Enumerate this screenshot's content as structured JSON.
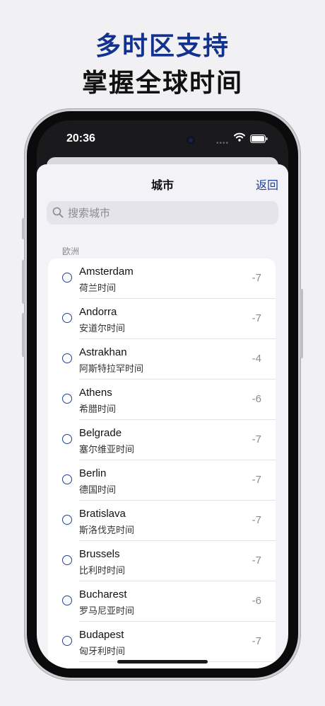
{
  "headline": {
    "line1": "多时区支持",
    "line2": "掌握全球时间"
  },
  "status_bar": {
    "time": "20:36"
  },
  "nav": {
    "title": "城市",
    "back_label": "返回"
  },
  "search": {
    "placeholder": "搜索城市",
    "value": ""
  },
  "section": {
    "header": "欧洲"
  },
  "cities": [
    {
      "name": "Amsterdam",
      "zh": "荷兰时间",
      "offset": "-7"
    },
    {
      "name": "Andorra",
      "zh": "安道尔时间",
      "offset": "-7"
    },
    {
      "name": "Astrakhan",
      "zh": "阿斯特拉罕时间",
      "offset": "-4"
    },
    {
      "name": "Athens",
      "zh": "希腊时间",
      "offset": "-6"
    },
    {
      "name": "Belgrade",
      "zh": "塞尔维亚时间",
      "offset": "-7"
    },
    {
      "name": "Berlin",
      "zh": "德国时间",
      "offset": "-7"
    },
    {
      "name": "Bratislava",
      "zh": "斯洛伐克时间",
      "offset": "-7"
    },
    {
      "name": "Brussels",
      "zh": "比利时时间",
      "offset": "-7"
    },
    {
      "name": "Bucharest",
      "zh": "罗马尼亚时间",
      "offset": "-6"
    },
    {
      "name": "Budapest",
      "zh": "匈牙利时间",
      "offset": "-7"
    }
  ],
  "colors": {
    "accent": "#1f3f9a",
    "headline_blue": "#13318f",
    "background": "#f1f1f3"
  }
}
